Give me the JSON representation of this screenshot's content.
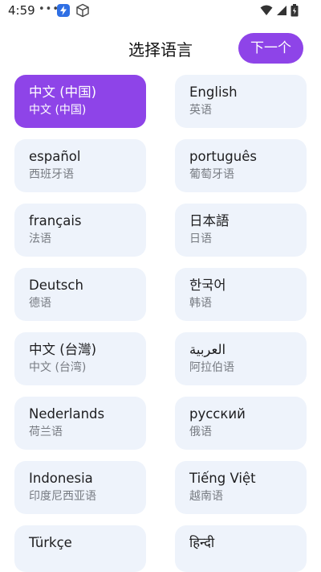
{
  "status_bar": {
    "time": "4:59",
    "dots": "•••"
  },
  "header": {
    "title": "选择语言",
    "next_label": "下一个"
  },
  "colors": {
    "accent": "#8e44e8",
    "card_bg": "#eef3fb"
  },
  "languages": [
    {
      "name": "中文 (中国)",
      "sub": "中文 (中国)",
      "selected": true
    },
    {
      "name": "English",
      "sub": "英语"
    },
    {
      "name": "español",
      "sub": "西班牙语"
    },
    {
      "name": "português",
      "sub": "葡萄牙语"
    },
    {
      "name": "français",
      "sub": "法语"
    },
    {
      "name": "日本語",
      "sub": "日语"
    },
    {
      "name": "Deutsch",
      "sub": "德语"
    },
    {
      "name": "한국어",
      "sub": "韩语"
    },
    {
      "name": "中文 (台灣)",
      "sub": "中文 (台湾)"
    },
    {
      "name": "العربية",
      "sub": "阿拉伯语"
    },
    {
      "name": "Nederlands",
      "sub": "荷兰语"
    },
    {
      "name": "русский",
      "sub": "俄语"
    },
    {
      "name": "Indonesia",
      "sub": "印度尼西亚语"
    },
    {
      "name": "Tiếng Việt",
      "sub": "越南语"
    },
    {
      "name": "Türkçe",
      "sub": ""
    },
    {
      "name": "हिन्दी",
      "sub": ""
    }
  ]
}
